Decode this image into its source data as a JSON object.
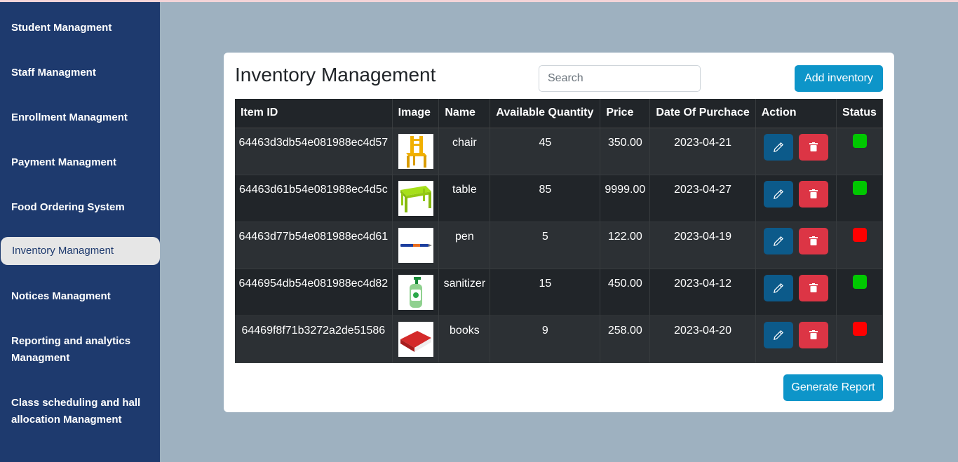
{
  "sidebar": {
    "items": [
      {
        "label": "Student Managment"
      },
      {
        "label": "Staff Managment"
      },
      {
        "label": "Enrollment Managment"
      },
      {
        "label": "Payment Managment"
      },
      {
        "label": "Food Ordering System"
      },
      {
        "label": "Inventory Managment"
      },
      {
        "label": "Notices Managment"
      },
      {
        "label": "Reporting and analytics Managment"
      },
      {
        "label": "Class scheduling and hall allocation Managment"
      }
    ],
    "active_label": "Inventory Managment"
  },
  "main": {
    "title": "Inventory Management",
    "search_placeholder": "Search",
    "add_label": "Add inventory",
    "report_label": "Generate Report"
  },
  "table": {
    "headers": [
      "Item ID",
      "Image",
      "Name",
      "Available Quantity",
      "Price",
      "Date Of Purchace",
      "Action",
      "Status"
    ],
    "rows": [
      {
        "id": "64463d3db54e081988ec4d57",
        "image": "chair-image",
        "name": "chair",
        "qty": "45",
        "price": "350.00",
        "date": "2023-04-21",
        "status": "green"
      },
      {
        "id": "64463d61b54e081988ec4d5c",
        "image": "table-image",
        "name": "table",
        "qty": "85",
        "price": "9999.00",
        "date": "2023-04-27",
        "status": "green"
      },
      {
        "id": "64463d77b54e081988ec4d61",
        "image": "pen-image",
        "name": "pen",
        "qty": "5",
        "price": "122.00",
        "date": "2023-04-19",
        "status": "red"
      },
      {
        "id": "6446954db54e081988ec4d82",
        "image": "sanitizer-image",
        "name": "sanitizer",
        "qty": "15",
        "price": "450.00",
        "date": "2023-04-12",
        "status": "green"
      },
      {
        "id": "64469f8f71b3272a2de51586",
        "image": "books-image",
        "name": "books",
        "qty": "9",
        "price": "258.00",
        "date": "2023-04-20",
        "status": "red"
      }
    ]
  },
  "colors": {
    "sidebar_bg": "#1e3a6e",
    "page_bg": "#9eb1c0",
    "accent_button": "#0d95c9",
    "edit_button": "#0c5a8a",
    "delete_button": "#dc3545",
    "status_green": "#00c800",
    "status_red": "#ff0000"
  },
  "icons": {
    "edit": "pencil-icon",
    "delete": "trash-icon"
  }
}
